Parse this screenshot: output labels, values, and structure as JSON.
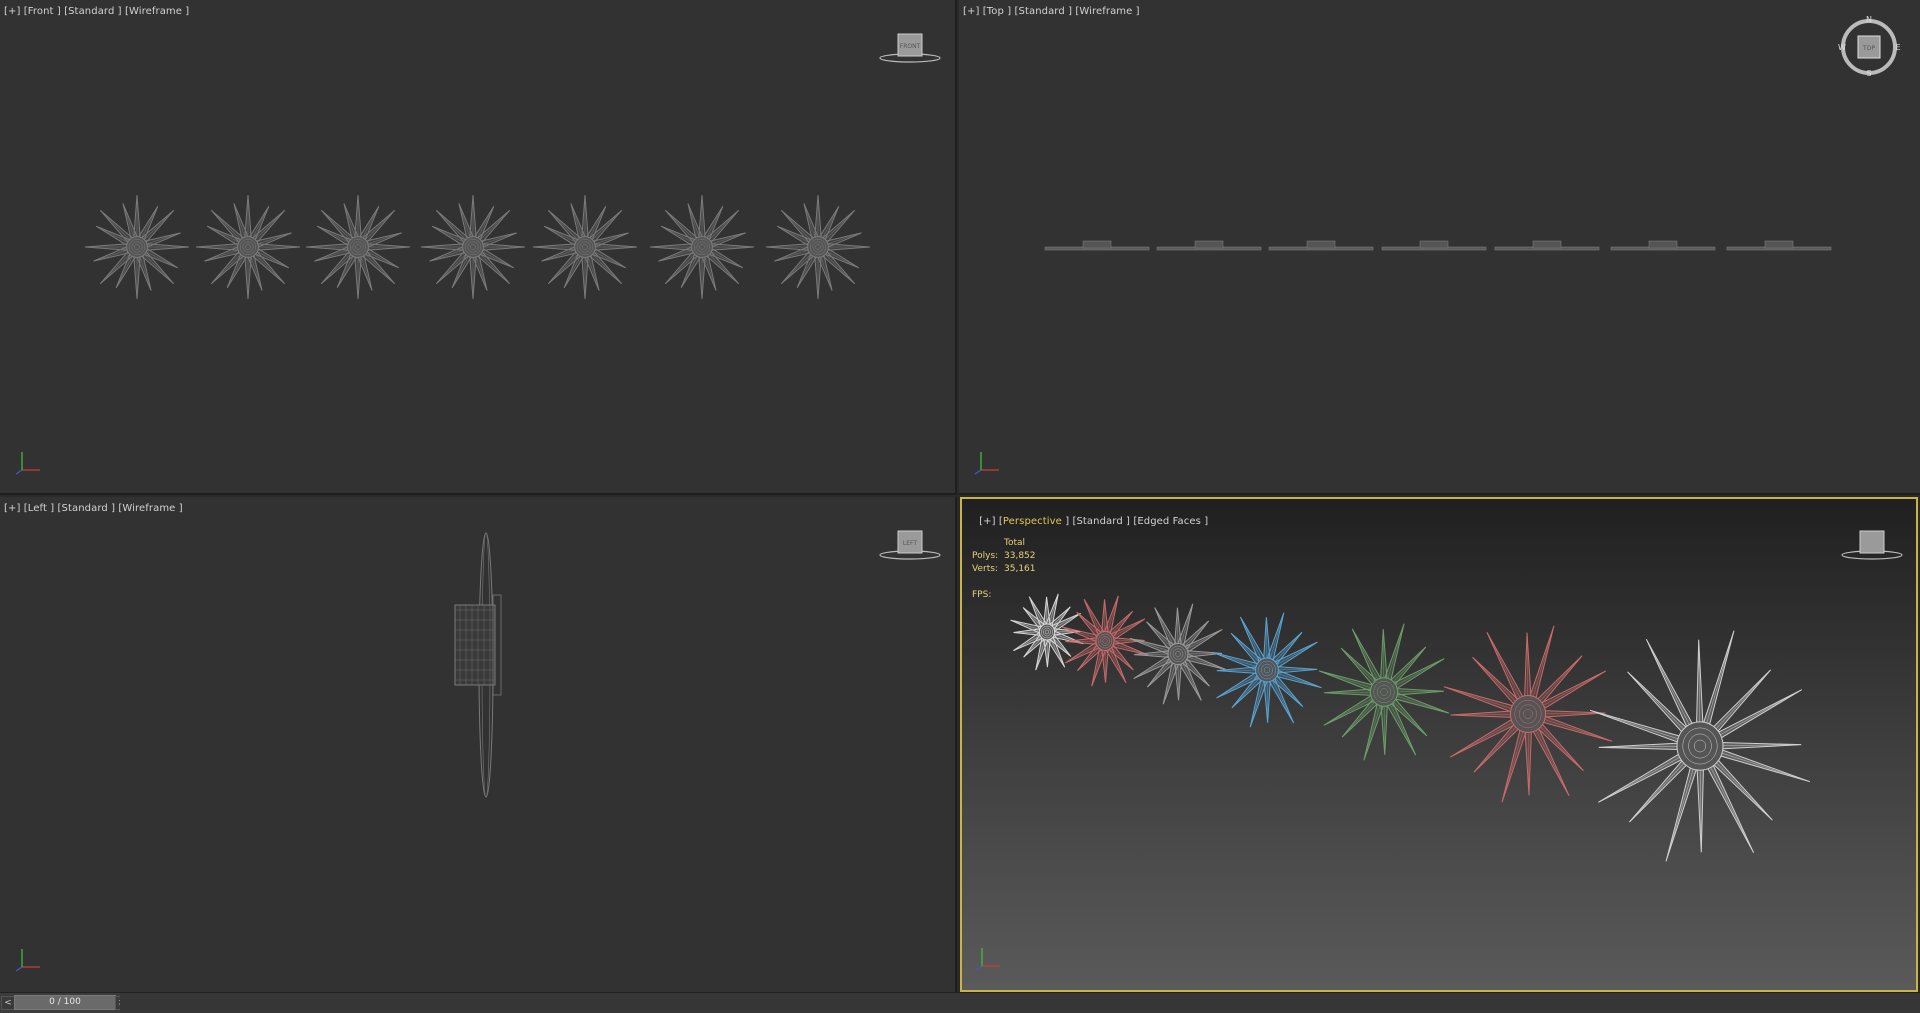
{
  "viewports": {
    "front": {
      "label": "[+] [Front ] [Standard ] [Wireframe ]",
      "cube_label": "FRONT"
    },
    "top": {
      "label": "[+] [Top ] [Standard ] [Wireframe ]",
      "cube_label": "TOP",
      "compass": {
        "n": "N",
        "s": "S",
        "e": "E",
        "w": "W"
      }
    },
    "left": {
      "label": "[+] [Left ] [Standard ] [Wireframe ]",
      "cube_label": "LEFT"
    },
    "perspective": {
      "label_prefix": "[+] [",
      "label_highlight": "Perspective ",
      "label_suffix": "] [Standard ] [Edged Faces ]",
      "stats": {
        "header": "Total",
        "polys_label": "Polys:",
        "polys": "33,852",
        "verts_label": "Verts:",
        "verts": "35,161",
        "fps_label": "FPS:"
      }
    }
  },
  "timeline": {
    "prev": "<",
    "next": ">",
    "frame": "0 / 100"
  },
  "colors": {
    "wire": "#7a7a7a",
    "active_border": "#c8b44a",
    "bg": "#2f2f2f",
    "clock_colors": [
      "#d8d8d8",
      "#c96b6b",
      "#9a9a9a",
      "#5aa6d6",
      "#6e9f6a",
      "#c96b6b",
      "#d0d0d0"
    ]
  }
}
